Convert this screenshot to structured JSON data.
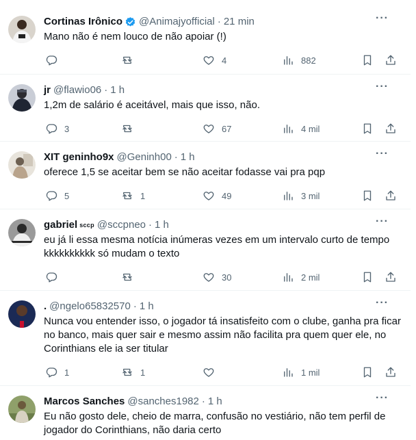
{
  "tweets": [
    {
      "name": "Cortinas Irônico",
      "verified": true,
      "badge": "",
      "handle": "@Animajyofficial",
      "sep": "·",
      "time": "21 min",
      "text": "Mano não é nem louco de não apoiar (!)",
      "replies": "",
      "retweets": "",
      "likes": "4",
      "views": "882",
      "avatar": "player-in-white-kit",
      "colors": {
        "bg": "#d9d4cc",
        "fg": "#f4f4f4",
        "accent": "#222222"
      }
    },
    {
      "name": "jr",
      "verified": false,
      "badge": "",
      "handle": "@flawio06",
      "sep": "·",
      "time": "1 h",
      "text": "1,2m de salário é aceitável, mais que isso, não.",
      "replies": "3",
      "retweets": "",
      "likes": "67",
      "views": "4 mil",
      "avatar": "person-in-dark-outfit",
      "colors": {
        "bg": "#c9cdd6",
        "fg": "#1f2533",
        "accent": "#4a4f5c"
      }
    },
    {
      "name": "XIT geninho9x",
      "verified": false,
      "badge": "",
      "handle": "@Geninh00",
      "sep": "·",
      "time": "1 h",
      "text": "oferece 1,5 se aceitar bem se não aceitar fodasse vai pra pqp",
      "replies": "5",
      "retweets": "1",
      "likes": "49",
      "views": "3 mil",
      "avatar": "person-in-light-room",
      "colors": {
        "bg": "#e8e4dc",
        "fg": "#b9a48c",
        "accent": "#6d6052"
      }
    },
    {
      "name": "gabriel",
      "verified": false,
      "badge": "sccp",
      "handle": "@sccpneo",
      "sep": "·",
      "time": "1 h",
      "text": "eu já li essa mesma notícia inúmeras vezes em um intervalo curto de tempo kkkkkkkkkk só mudam o texto",
      "replies": "",
      "retweets": "",
      "likes": "30",
      "views": "2 mil",
      "avatar": "player-black-and-white",
      "colors": {
        "bg": "#9a9a9a",
        "fg": "#f0f0f0",
        "accent": "#2a2a2a"
      }
    },
    {
      "name": ".",
      "verified": false,
      "badge": "",
      "handle": "@ngelo65832570",
      "sep": "·",
      "time": "1 h",
      "text": "Nunca vou entender isso, o jogador tá insatisfeito com o clube, ganha pra ficar no banco, mais quer sair e mesmo assim não facilita pra quem quer ele, no Corinthians ele ia ser titular",
      "replies": "1",
      "retweets": "1",
      "likes": "",
      "views": "1 mil",
      "avatar": "player-in-blue-kit",
      "colors": {
        "bg": "#1b2a55",
        "fg": "#5a3b2a",
        "accent": "#c8102e"
      }
    },
    {
      "name": "Marcos Sanches",
      "verified": false,
      "badge": "",
      "handle": "@sanches1982",
      "sep": "·",
      "time": "1 h",
      "text": "Eu não gosto dele, cheio de marra, confusão no vestiário, não tem perfil de jogador do Corinthians, não daria certo",
      "replies": "",
      "retweets": "",
      "likes": "",
      "views": "",
      "avatar": "person-outdoors-field",
      "colors": {
        "bg": "#8fa06a",
        "fg": "#6b5a3c",
        "accent": "#d8d2c2"
      }
    }
  ],
  "icons": {
    "more": "more-icon",
    "reply": "reply-icon",
    "retweet": "retweet-icon",
    "like": "heart-icon",
    "views": "views-icon",
    "bookmark": "bookmark-icon",
    "share": "share-icon",
    "verified": "verified-badge-icon"
  },
  "accent": "#1d9bf0",
  "muted": "#536471"
}
